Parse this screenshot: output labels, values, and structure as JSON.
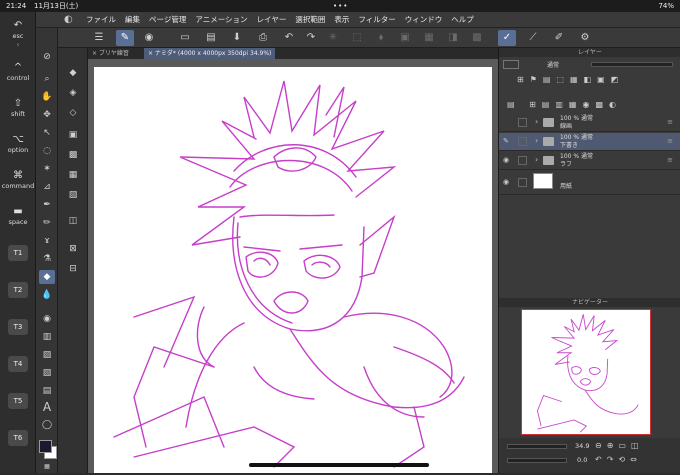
{
  "status": {
    "time": "21:24",
    "date": "11月13日(土)",
    "dots": "•••",
    "battery": "74%"
  },
  "menu": {
    "items": [
      "ファイル",
      "編集",
      "ページ管理",
      "アニメーション",
      "レイヤー",
      "選択範囲",
      "表示",
      "フィルター",
      "ウィンドウ",
      "ヘルプ"
    ]
  },
  "modkeys": {
    "esc": "esc",
    "control": "control",
    "shift": "shift",
    "option": "option",
    "command": "command",
    "space": "space",
    "t1": "T1",
    "t2": "T2",
    "t3": "T3",
    "t4": "T4",
    "t5": "T5",
    "t6": "T6"
  },
  "tabs": {
    "tab1": "× ブリヤ練習",
    "tab2": "× ナミダ* (4000 x 4000px 350dpi 34.9%)"
  },
  "layers": {
    "panel_title": "レイヤー",
    "blend_mode": "通常",
    "rows": [
      {
        "opacity": "100 % 通常",
        "name": "線画"
      },
      {
        "opacity": "100 % 通常",
        "name": "下書き"
      },
      {
        "opacity": "100 % 通常",
        "name": "ラフ"
      },
      {
        "opacity": "",
        "name": "用紙"
      }
    ]
  },
  "navigator": {
    "title": "ナビゲーター",
    "zoom": "34.9",
    "rotation": "0.0"
  },
  "colors": {
    "accent": "#5a6f95",
    "sketch": "#c02ac4",
    "main": "#1a1a2e",
    "sub": "#ffffff"
  }
}
